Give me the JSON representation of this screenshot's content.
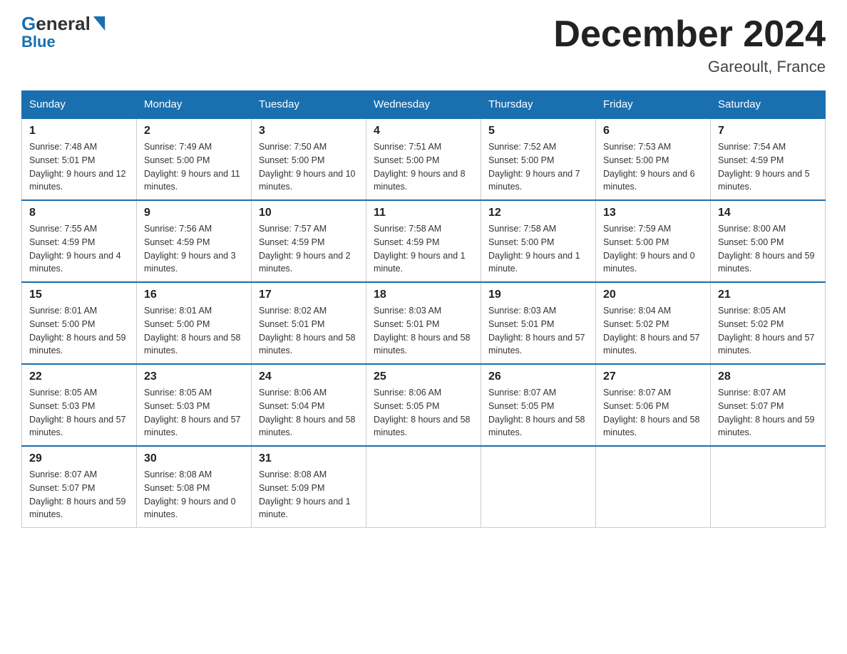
{
  "header": {
    "logo_line1": "General",
    "logo_line2": "Blue",
    "month_title": "December 2024",
    "location": "Gareoult, France"
  },
  "calendar": {
    "days_of_week": [
      "Sunday",
      "Monday",
      "Tuesday",
      "Wednesday",
      "Thursday",
      "Friday",
      "Saturday"
    ],
    "weeks": [
      [
        {
          "date": "1",
          "sunrise": "7:48 AM",
          "sunset": "5:01 PM",
          "daylight": "9 hours and 12 minutes."
        },
        {
          "date": "2",
          "sunrise": "7:49 AM",
          "sunset": "5:00 PM",
          "daylight": "9 hours and 11 minutes."
        },
        {
          "date": "3",
          "sunrise": "7:50 AM",
          "sunset": "5:00 PM",
          "daylight": "9 hours and 10 minutes."
        },
        {
          "date": "4",
          "sunrise": "7:51 AM",
          "sunset": "5:00 PM",
          "daylight": "9 hours and 8 minutes."
        },
        {
          "date": "5",
          "sunrise": "7:52 AM",
          "sunset": "5:00 PM",
          "daylight": "9 hours and 7 minutes."
        },
        {
          "date": "6",
          "sunrise": "7:53 AM",
          "sunset": "5:00 PM",
          "daylight": "9 hours and 6 minutes."
        },
        {
          "date": "7",
          "sunrise": "7:54 AM",
          "sunset": "4:59 PM",
          "daylight": "9 hours and 5 minutes."
        }
      ],
      [
        {
          "date": "8",
          "sunrise": "7:55 AM",
          "sunset": "4:59 PM",
          "daylight": "9 hours and 4 minutes."
        },
        {
          "date": "9",
          "sunrise": "7:56 AM",
          "sunset": "4:59 PM",
          "daylight": "9 hours and 3 minutes."
        },
        {
          "date": "10",
          "sunrise": "7:57 AM",
          "sunset": "4:59 PM",
          "daylight": "9 hours and 2 minutes."
        },
        {
          "date": "11",
          "sunrise": "7:58 AM",
          "sunset": "4:59 PM",
          "daylight": "9 hours and 1 minute."
        },
        {
          "date": "12",
          "sunrise": "7:58 AM",
          "sunset": "5:00 PM",
          "daylight": "9 hours and 1 minute."
        },
        {
          "date": "13",
          "sunrise": "7:59 AM",
          "sunset": "5:00 PM",
          "daylight": "9 hours and 0 minutes."
        },
        {
          "date": "14",
          "sunrise": "8:00 AM",
          "sunset": "5:00 PM",
          "daylight": "8 hours and 59 minutes."
        }
      ],
      [
        {
          "date": "15",
          "sunrise": "8:01 AM",
          "sunset": "5:00 PM",
          "daylight": "8 hours and 59 minutes."
        },
        {
          "date": "16",
          "sunrise": "8:01 AM",
          "sunset": "5:00 PM",
          "daylight": "8 hours and 58 minutes."
        },
        {
          "date": "17",
          "sunrise": "8:02 AM",
          "sunset": "5:01 PM",
          "daylight": "8 hours and 58 minutes."
        },
        {
          "date": "18",
          "sunrise": "8:03 AM",
          "sunset": "5:01 PM",
          "daylight": "8 hours and 58 minutes."
        },
        {
          "date": "19",
          "sunrise": "8:03 AM",
          "sunset": "5:01 PM",
          "daylight": "8 hours and 57 minutes."
        },
        {
          "date": "20",
          "sunrise": "8:04 AM",
          "sunset": "5:02 PM",
          "daylight": "8 hours and 57 minutes."
        },
        {
          "date": "21",
          "sunrise": "8:05 AM",
          "sunset": "5:02 PM",
          "daylight": "8 hours and 57 minutes."
        }
      ],
      [
        {
          "date": "22",
          "sunrise": "8:05 AM",
          "sunset": "5:03 PM",
          "daylight": "8 hours and 57 minutes."
        },
        {
          "date": "23",
          "sunrise": "8:05 AM",
          "sunset": "5:03 PM",
          "daylight": "8 hours and 57 minutes."
        },
        {
          "date": "24",
          "sunrise": "8:06 AM",
          "sunset": "5:04 PM",
          "daylight": "8 hours and 58 minutes."
        },
        {
          "date": "25",
          "sunrise": "8:06 AM",
          "sunset": "5:05 PM",
          "daylight": "8 hours and 58 minutes."
        },
        {
          "date": "26",
          "sunrise": "8:07 AM",
          "sunset": "5:05 PM",
          "daylight": "8 hours and 58 minutes."
        },
        {
          "date": "27",
          "sunrise": "8:07 AM",
          "sunset": "5:06 PM",
          "daylight": "8 hours and 58 minutes."
        },
        {
          "date": "28",
          "sunrise": "8:07 AM",
          "sunset": "5:07 PM",
          "daylight": "8 hours and 59 minutes."
        }
      ],
      [
        {
          "date": "29",
          "sunrise": "8:07 AM",
          "sunset": "5:07 PM",
          "daylight": "8 hours and 59 minutes."
        },
        {
          "date": "30",
          "sunrise": "8:08 AM",
          "sunset": "5:08 PM",
          "daylight": "9 hours and 0 minutes."
        },
        {
          "date": "31",
          "sunrise": "8:08 AM",
          "sunset": "5:09 PM",
          "daylight": "9 hours and 1 minute."
        },
        null,
        null,
        null,
        null
      ]
    ],
    "labels": {
      "sunrise": "Sunrise:",
      "sunset": "Sunset:",
      "daylight": "Daylight:"
    }
  }
}
